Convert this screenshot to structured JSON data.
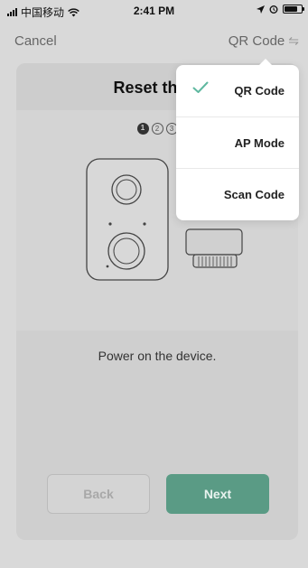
{
  "status_bar": {
    "carrier": "中国移动",
    "time": "2:41 PM"
  },
  "nav": {
    "cancel_label": "Cancel",
    "mode_label": "QR Code",
    "swap_icon": "⇋"
  },
  "card": {
    "title": "Reset the d",
    "steps": [
      "1",
      "2",
      "3"
    ],
    "active_step": 1,
    "instruction": "Power on the device."
  },
  "buttons": {
    "back_label": "Back",
    "next_label": "Next"
  },
  "dropdown": {
    "items": [
      {
        "label": "QR Code",
        "selected": true
      },
      {
        "label": "AP Mode",
        "selected": false
      },
      {
        "label": "Scan Code",
        "selected": false
      }
    ]
  },
  "colors": {
    "accent": "#5a9b85",
    "check": "#5fb8a0"
  }
}
